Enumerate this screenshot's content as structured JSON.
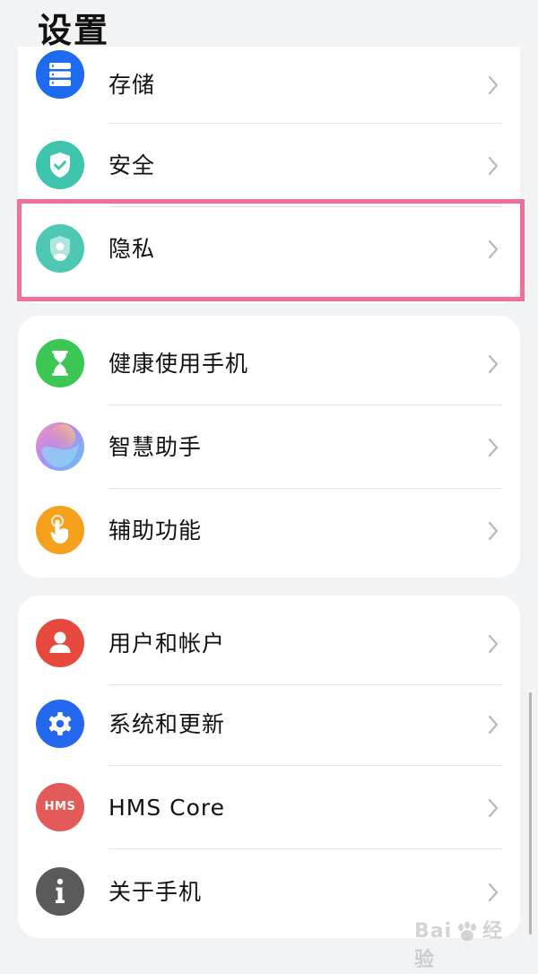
{
  "page": {
    "title": "设置"
  },
  "colors": {
    "storage": "#1f6bf0",
    "security": "#3fc4ae",
    "privacy": "#4fc8b3",
    "health": "#3cc653",
    "assistant": "#b08cf2",
    "accessibility": "#f5a11e",
    "accounts": "#e8493d",
    "system": "#2468f0",
    "hms": "#e45a58",
    "about": "#5a5a5a",
    "highlight": "#ef6f97"
  },
  "groups": [
    {
      "items": [
        {
          "label": "存储",
          "icon": "storage-icon"
        },
        {
          "label": "安全",
          "icon": "shield-check-icon"
        },
        {
          "label": "隐私",
          "icon": "privacy-shield-icon"
        }
      ]
    },
    {
      "items": [
        {
          "label": "健康使用手机",
          "icon": "hourglass-icon"
        },
        {
          "label": "智慧助手",
          "icon": "assistant-orb-icon"
        },
        {
          "label": "辅助功能",
          "icon": "hand-touch-icon"
        }
      ]
    },
    {
      "items": [
        {
          "label": "用户和帐户",
          "icon": "user-icon"
        },
        {
          "label": "系统和更新",
          "icon": "gear-icon"
        },
        {
          "label": "HMS Core",
          "icon": "hms-icon",
          "icon_text": "HMS"
        },
        {
          "label": "关于手机",
          "icon": "info-icon"
        }
      ]
    }
  ],
  "watermark": {
    "text_left": "Bai",
    "text_right": "经验"
  }
}
